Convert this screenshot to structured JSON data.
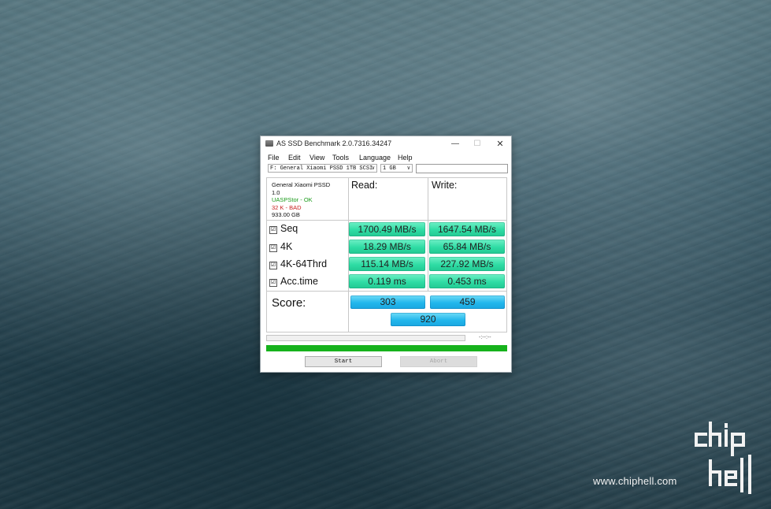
{
  "window": {
    "title": "AS SSD Benchmark 2.0.7316.34247",
    "controls": {
      "minimize": "—",
      "maximize": "☐",
      "close": "✕"
    }
  },
  "menu": [
    "File",
    "Edit",
    "View",
    "Tools",
    "Language",
    "Help"
  ],
  "selectors": {
    "drive": "F: General Xiaomi PSSD 1TB SCSI D",
    "size": "1 GB"
  },
  "drive_info": {
    "name": "General Xiaomi PSSD",
    "firmware": "1.0",
    "driver": "UASPStor - OK",
    "alignment": "32 K - BAD",
    "capacity": "933.00 GB"
  },
  "headers": {
    "read": "Read:",
    "write": "Write:"
  },
  "tests": [
    {
      "label": "Seq",
      "checked": true,
      "read": "1700.49 MB/s",
      "write": "1647.54 MB/s"
    },
    {
      "label": "4K",
      "checked": true,
      "read": "18.29 MB/s",
      "write": "65.84 MB/s"
    },
    {
      "label": "4K-64Thrd",
      "checked": true,
      "read": "115.14 MB/s",
      "write": "227.92 MB/s"
    },
    {
      "label": "Acc.time",
      "checked": true,
      "read": "0.119 ms",
      "write": "0.453 ms"
    }
  ],
  "score": {
    "label": "Score:",
    "read": "303",
    "write": "459",
    "total": "920"
  },
  "progress": {
    "time": "-:--:--",
    "percent": 100
  },
  "buttons": {
    "start": "Start",
    "abort": "Abort"
  },
  "watermark": {
    "url": "www.chiphell.com"
  },
  "colors": {
    "result": "#2fdca4",
    "score": "#22b7ec",
    "progress": "#16b21c",
    "ok": "#1a9a1a",
    "bad": "#c82020"
  }
}
